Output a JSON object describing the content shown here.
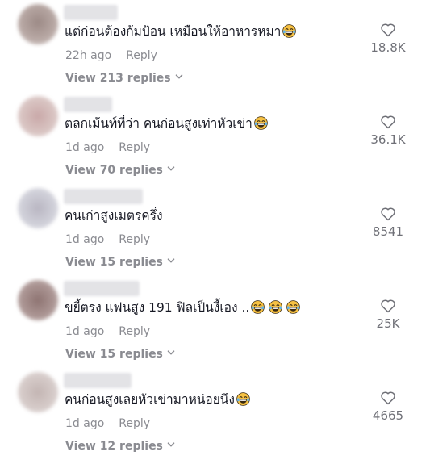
{
  "comments": [
    {
      "text": "แต่ก่อนต้องก้มป้อน เหมือนให้อาหารหมา",
      "emojis": [
        "grinning-tears-emoji"
      ],
      "time": "22h ago",
      "reply_label": "Reply",
      "view_replies": "View 213 replies",
      "likes": "18.8K"
    },
    {
      "text": "ตลกเม้นท์ที่ว่า คนก่อนสูงเท่าหัวเข่า",
      "emojis": [
        "grinning-tears-emoji"
      ],
      "time": "1d ago",
      "reply_label": "Reply",
      "view_replies": "View 70 replies",
      "likes": "36.1K"
    },
    {
      "text": "คนเก่าสูงเมตรครึ่ง",
      "emojis": [],
      "time": "1d ago",
      "reply_label": "Reply",
      "view_replies": "View 15 replies",
      "likes": "8541"
    },
    {
      "text": "ขยี้ตรง แฟนสูง 191 ฟิลเป็นงี้เอง ..",
      "emojis": [
        "grinning-tears-emoji",
        "grinning-tears-emoji",
        "grinning-tears-emoji"
      ],
      "time": "1d ago",
      "reply_label": "Reply",
      "view_replies": "View 15 replies",
      "likes": "25K"
    },
    {
      "text": "คนก่อนสูงเลยหัวเข่ามาหน่อยนึง",
      "emojis": [
        "grinning-tears-emoji"
      ],
      "time": "1d ago",
      "reply_label": "Reply",
      "view_replies": "View 12 replies",
      "likes": "4665"
    }
  ],
  "colors": {
    "text": "#161823",
    "secondary": "#8a8b91",
    "like_count": "#6f7077",
    "emoji_face": "#f6c143"
  }
}
